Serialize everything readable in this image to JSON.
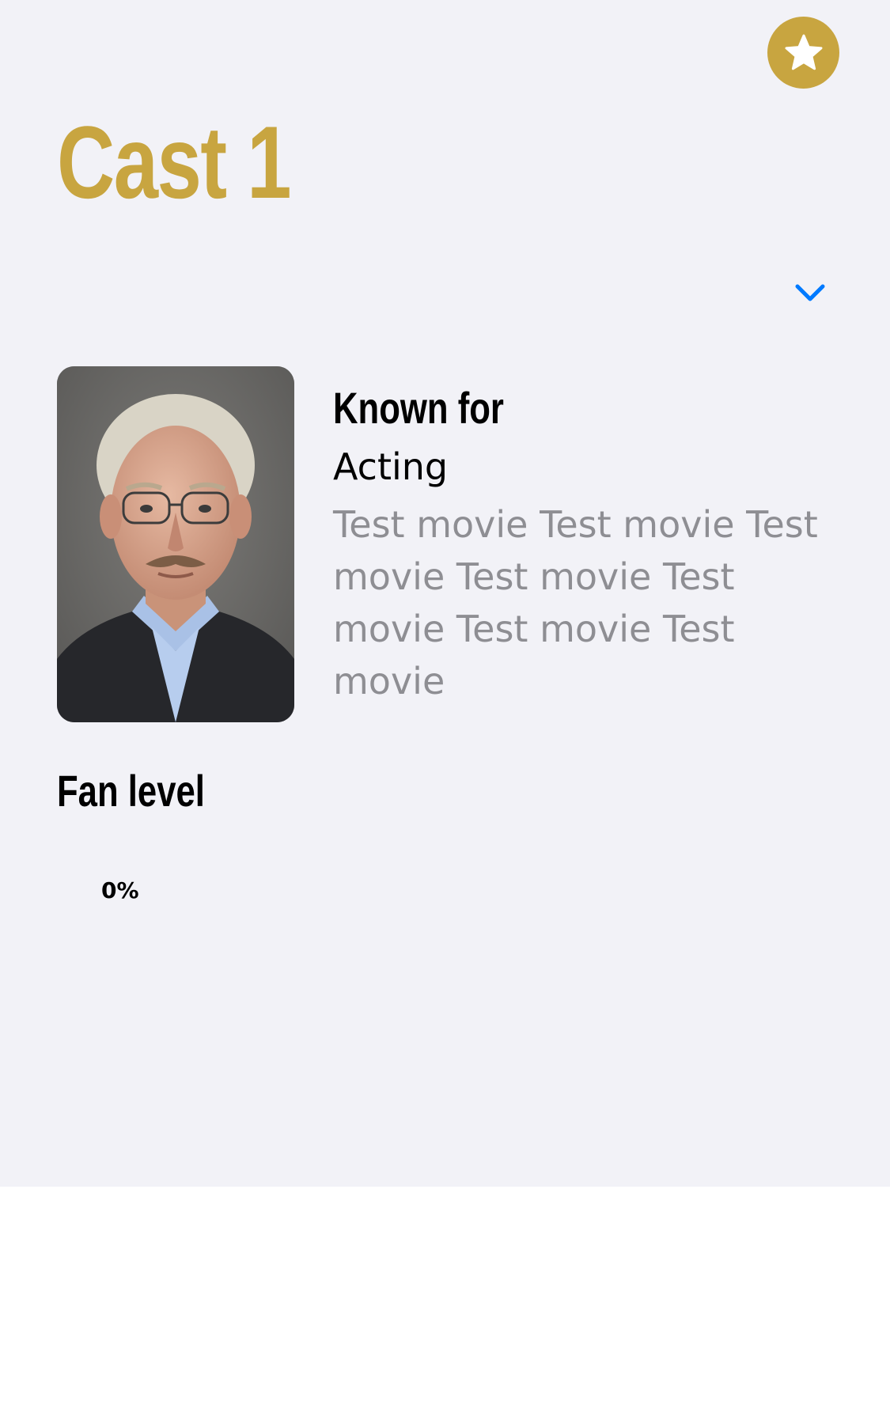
{
  "header": {
    "title": "Cast 1",
    "favorite_icon": "star-icon",
    "accent_color": "#c8a540"
  },
  "toggle": {
    "icon": "chevron-down-icon",
    "color": "#007aff"
  },
  "profile": {
    "known_for_heading": "Known for",
    "department": "Acting",
    "known_for_text": "Test movie Test movie Test movie Test movie Test movie Test movie Test movie"
  },
  "fan_level": {
    "heading": "Fan level",
    "value_label": "0%",
    "value": 0
  }
}
